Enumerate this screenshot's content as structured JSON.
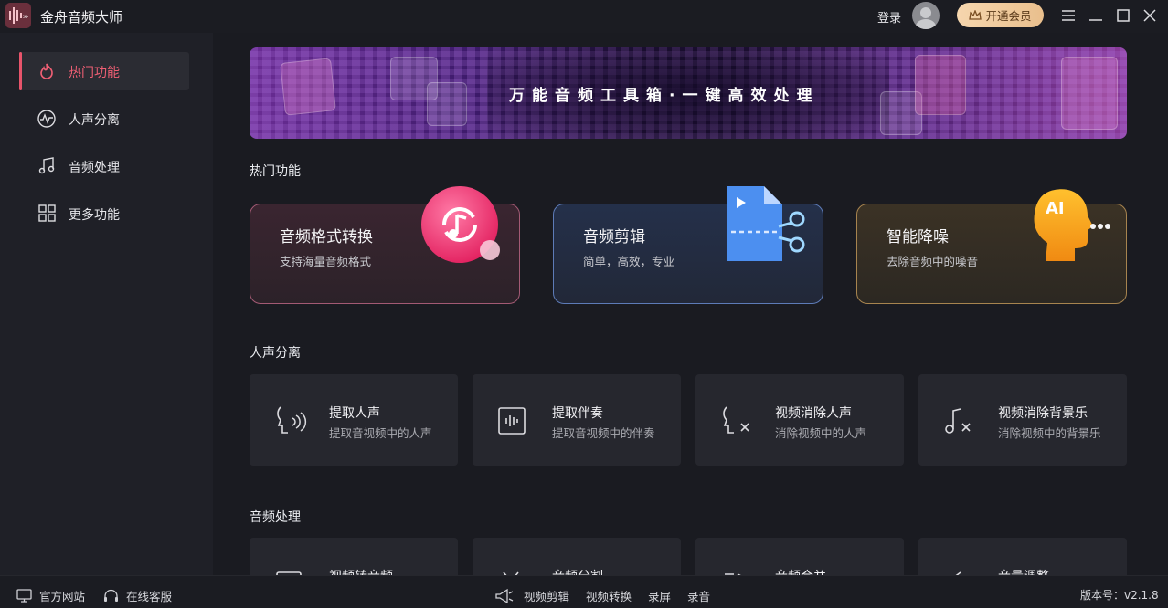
{
  "app": {
    "title": "金舟音频大师"
  },
  "header": {
    "login": "登录",
    "vip_label": "开通会员"
  },
  "sidebar": {
    "items": [
      {
        "label": "热门功能",
        "active": true,
        "icon": "fire-icon"
      },
      {
        "label": "人声分离",
        "active": false,
        "icon": "waveform-icon"
      },
      {
        "label": "音频处理",
        "active": false,
        "icon": "music-note-icon"
      },
      {
        "label": "更多功能",
        "active": false,
        "icon": "grid-icon"
      }
    ]
  },
  "banner": {
    "text": "万能音频工具箱·一键高效处理"
  },
  "hot": {
    "title": "热门功能",
    "cards": [
      {
        "title": "音频格式转换",
        "subtitle": "支持海量音频格式",
        "icon": "audio-convert-icon"
      },
      {
        "title": "音频剪辑",
        "subtitle": "简单，高效，专业",
        "icon": "scissors-icon"
      },
      {
        "title": "智能降噪",
        "subtitle": "去除音频中的噪音",
        "icon": "ai-denoise-icon"
      }
    ]
  },
  "vocal": {
    "title": "人声分离",
    "cards": [
      {
        "title": "提取人声",
        "subtitle": "提取音视频中的人声",
        "icon": "voice-extract-icon"
      },
      {
        "title": "提取伴奏",
        "subtitle": "提取音视频中的伴奏",
        "icon": "accompaniment-icon"
      },
      {
        "title": "视频消除人声",
        "subtitle": "消除视频中的人声",
        "icon": "remove-voice-icon"
      },
      {
        "title": "视频消除背景乐",
        "subtitle": "消除视频中的背景乐",
        "icon": "remove-music-icon"
      }
    ]
  },
  "audio": {
    "title": "音频处理",
    "cards": [
      {
        "title": "视频转音频"
      },
      {
        "title": "音频分割"
      },
      {
        "title": "音频合并"
      },
      {
        "title": "音量调整"
      }
    ]
  },
  "footer": {
    "website": "官方网站",
    "service": "在线客服",
    "links": [
      "视频剪辑",
      "视频转换",
      "录屏",
      "录音"
    ],
    "version": "版本号：v2.1.8"
  },
  "colors": {
    "accent": "#ef5f74",
    "vip": "#f0c896"
  }
}
